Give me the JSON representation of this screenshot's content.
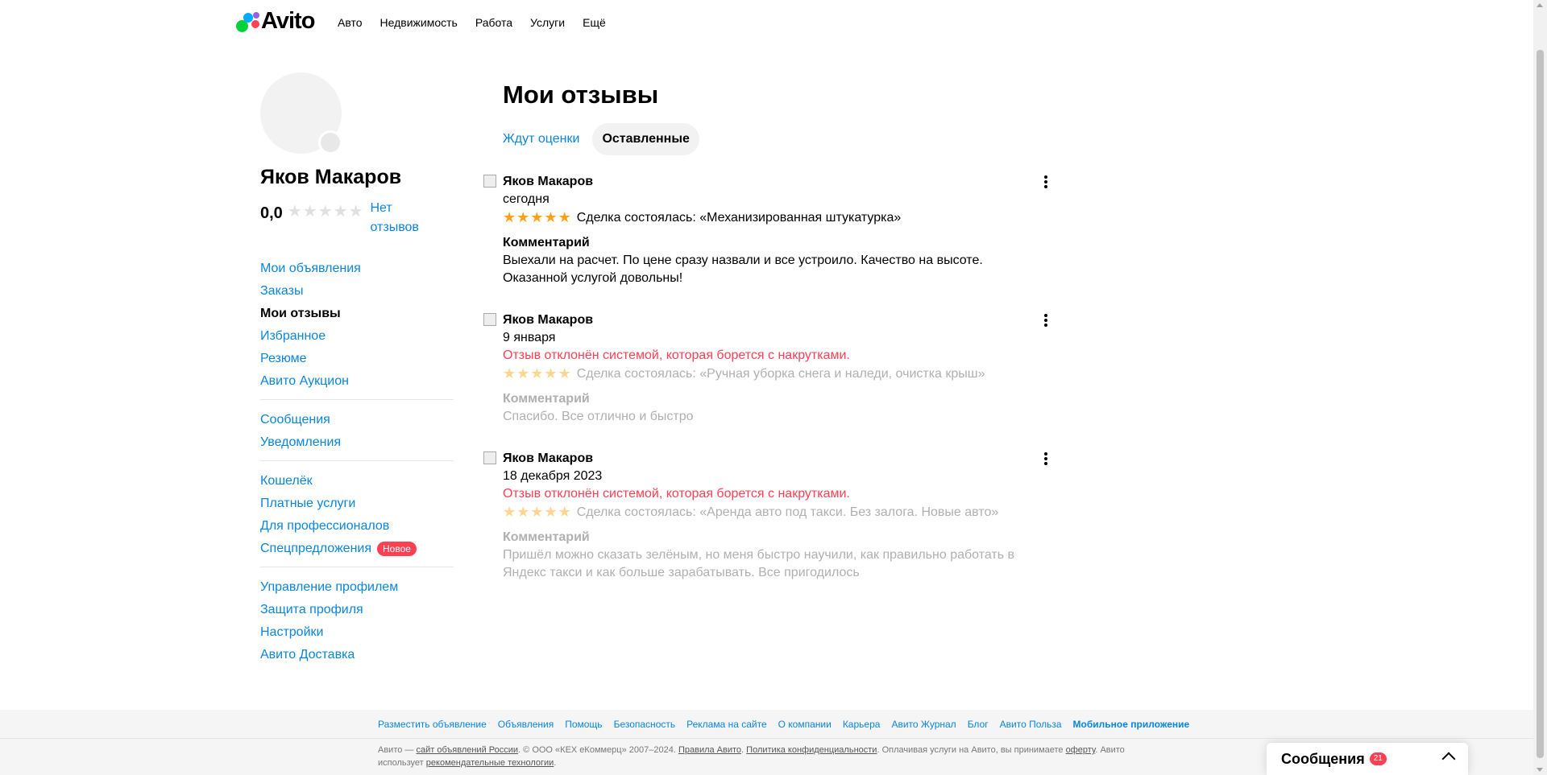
{
  "header": {
    "logo_text": "Avito",
    "nav": [
      "Авто",
      "Недвижимость",
      "Работа",
      "Услуги",
      "Ещё"
    ]
  },
  "profile": {
    "name": "Яков Макаров",
    "rating": "0,0",
    "no_reviews": "Нет отзывов"
  },
  "sidebar": {
    "group1": [
      "Мои объявления",
      "Заказы",
      "Мои отзывы",
      "Избранное",
      "Резюме",
      "Авито Аукцион"
    ],
    "group2": [
      "Сообщения",
      "Уведомления"
    ],
    "group3": [
      "Кошелёк",
      "Платные услуги",
      "Для профессионалов",
      "Спецпредложения"
    ],
    "new_badge": "Новое",
    "group4": [
      "Управление профилем",
      "Защита профиля",
      "Настройки",
      "Авито Доставка"
    ]
  },
  "main": {
    "title": "Мои отзывы",
    "tabs": [
      "Ждут оценки",
      "Оставленные"
    ]
  },
  "reviews": [
    {
      "author": "Яков Макаров",
      "date": "сегодня",
      "error": "",
      "stars": 5,
      "deal": "Сделка состоялась: «Механизированная штукатурка»",
      "comment_label": "Комментарий",
      "comment": "Выехали на расчет. По цене сразу назвали и все устроило. Качество на высоте. Оказанной услугой довольны!"
    },
    {
      "author": "Яков Макаров",
      "date": "9 января",
      "error": "Отзыв отклонён системой, которая борется с накрутками.",
      "stars": 5,
      "deal": "Сделка состоялась: «Ручная уборка снега и наледи, очистка крыш»",
      "comment_label": "Комментарий",
      "comment": "Спасибо. Все отлично и быстро"
    },
    {
      "author": "Яков Макаров",
      "date": "18 декабря 2023",
      "error": "Отзыв отклонён системой, которая борется с накрутками.",
      "stars": 5,
      "deal": "Сделка состоялась: «Аренда авто под такси. Без залога. Новые авто»",
      "comment_label": "Комментарий",
      "comment": "Пришёл можно сказать зелёным, но меня быстро научили, как правильно работать в Яндекс такси и как больше зарабатывать. Все пригодилось"
    }
  ],
  "footer": {
    "links": [
      "Разместить объявление",
      "Объявления",
      "Помощь",
      "Безопасность",
      "Реклама на сайте",
      "О компании",
      "Карьера",
      "Авито Журнал",
      "Блог",
      "Авито Польза",
      "Мобильное приложение"
    ],
    "legal_1": "Авито — ",
    "legal_link_1": "сайт объявлений России",
    "legal_2": ". © ООО «КЕХ еКоммерц» 2007–2024. ",
    "legal_link_2": "Правила Авито",
    "legal_3": ". ",
    "legal_link_3": "Политика конфиденциальности",
    "legal_4": ". Оплачивая услуги на Авито, вы принимаете ",
    "legal_link_4": "оферту",
    "legal_5": ". Авито использует ",
    "legal_link_5": "рекомендательные технологии",
    "legal_6": "."
  },
  "messages_widget": {
    "label": "Сообщения",
    "count": "21"
  },
  "colors": {
    "link": "#0a85e0",
    "error": "#ff4053",
    "star": "#ffa117"
  }
}
